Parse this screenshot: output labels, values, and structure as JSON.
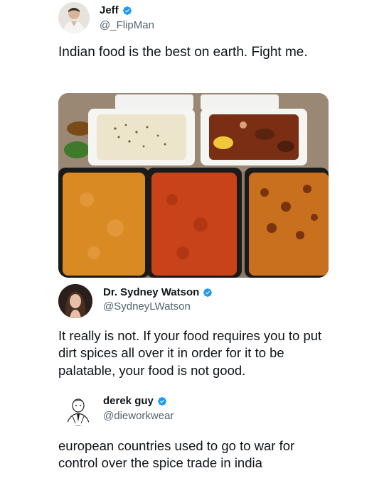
{
  "tweet1": {
    "name": "Jeff",
    "handle": "@_FlipMan",
    "text": "Indian food is the best on earth. Fight me.",
    "verified_color": "#1d9bf0"
  },
  "tweet2": {
    "name": "Dr. Sydney Watson",
    "handle": "@SydneyLWatson",
    "text": "It really is not. If your food requires you to put dirt spices all over it in order for it to be palatable, your food is not good.",
    "verified_color": "#1d9bf0"
  },
  "tweet3": {
    "name": "derek guy",
    "handle": "@dieworkwear",
    "text": "european countries used to go to war for control over the spice trade in india",
    "verified_color": "#1d9bf0"
  },
  "colors": {
    "text": "#0f1419",
    "secondary": "#536471",
    "verified": "#1d9bf0"
  }
}
